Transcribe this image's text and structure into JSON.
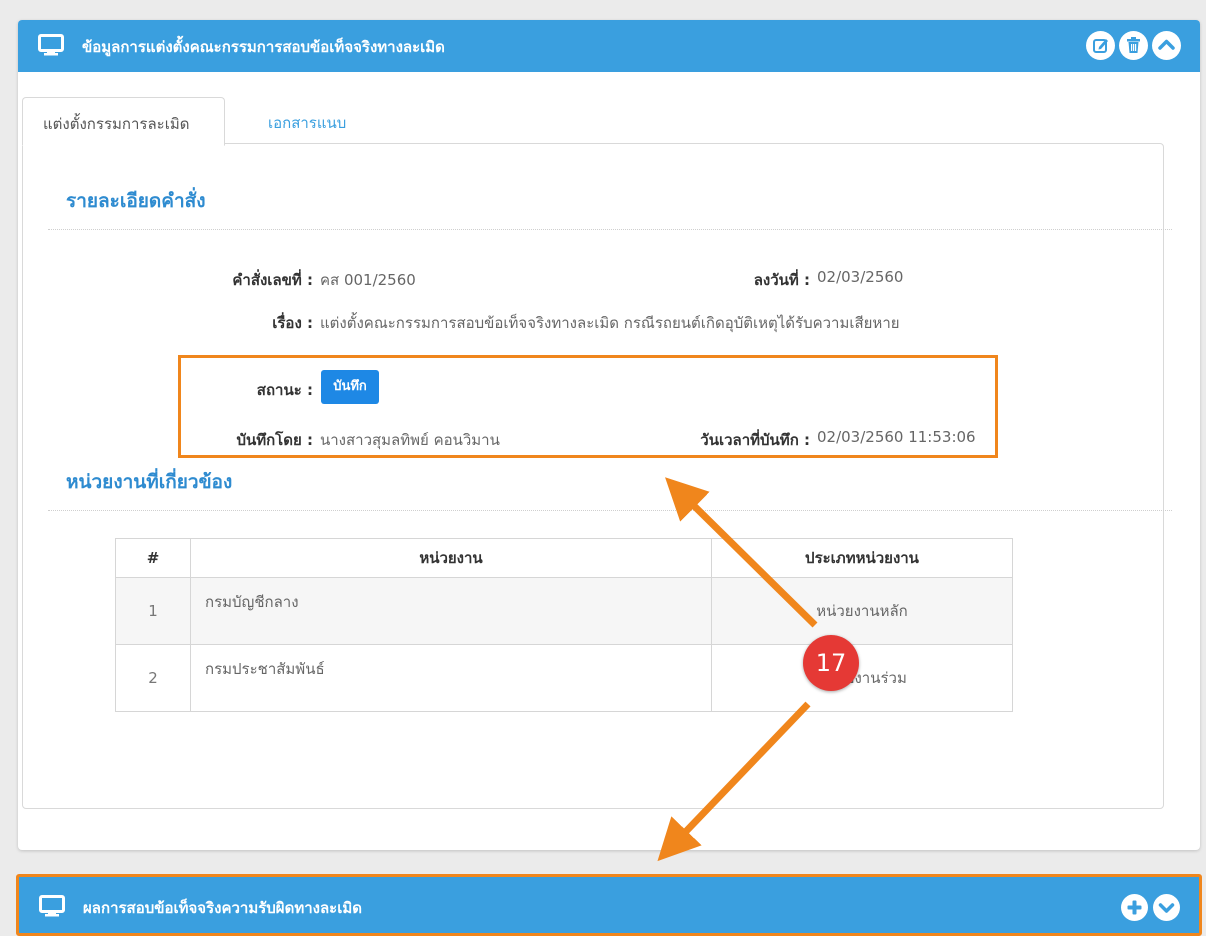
{
  "panel": {
    "title": "ข้อมูลการแต่งตั้งคณะกรรมการสอบข้อเท็จจริงทางละเมิด",
    "icons": [
      "monitor-icon",
      "edit-icon",
      "trash-icon",
      "collapse-icon"
    ]
  },
  "tabs": [
    {
      "label": "แต่งตั้งกรรมการละเมิด",
      "active": true
    },
    {
      "label": "เอกสารแนบ",
      "active": false
    }
  ],
  "order_details": {
    "section_title": "รายละเอียดคำสั่ง",
    "order_no_label": "คำสั่งเลขที่ :",
    "order_no": "คส 001/2560",
    "signed_date_label": "ลงวันที่ :",
    "signed_date": "02/03/2560",
    "subject_label": "เรื่อง :",
    "subject": "แต่งตั้งคณะกรรมการสอบข้อเท็จจริงทางละเมิด กรณีรถยนต์เกิดอุบัติเหตุได้รับความเสียหาย",
    "status_label": "สถานะ :",
    "status": "บันทึก",
    "recorded_by_label": "บันทึกโดย :",
    "recorded_by": "นางสาวสุมลทิพย์ คอนวิมาน",
    "recorded_at_label": "วันเวลาที่บันทึก :",
    "recorded_at": "02/03/2560 11:53:06"
  },
  "related_units": {
    "section_title": "หน่วยงานที่เกี่ยวข้อง",
    "columns": [
      "#",
      "หน่วยงาน",
      "ประเภทหน่วยงาน"
    ],
    "rows": [
      {
        "num": "1",
        "name": "กรมบัญชีกลาง",
        "type": "หน่วยงานหลัก"
      },
      {
        "num": "2",
        "name": "กรมประชาสัมพันธ์",
        "type": "หน่วยงานร่วม"
      }
    ]
  },
  "panel2": {
    "title": "ผลการสอบข้อเท็จจริงความรับผิดทางละเมิด",
    "icons": [
      "monitor-icon",
      "add-icon",
      "expand-icon"
    ]
  },
  "annotation": {
    "marker": "17",
    "color": "#f0861c",
    "marker_color": "#e53935"
  },
  "colors": {
    "header": "#3a9fdf",
    "section_title": "#2e8bd0",
    "badge": "#1e88e5",
    "background": "#ebebeb"
  }
}
